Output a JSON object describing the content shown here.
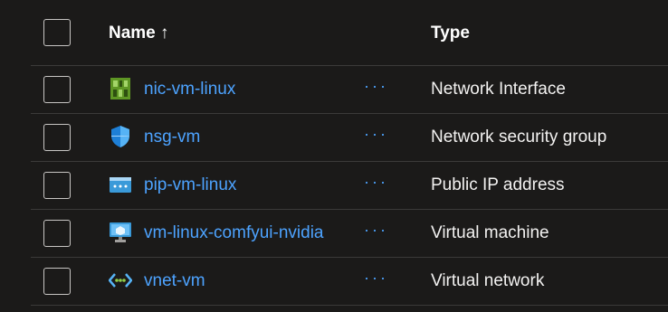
{
  "header": {
    "name_label": "Name ↑",
    "type_label": "Type"
  },
  "rows": [
    {
      "name": "nic-vm-linux",
      "type": "Network Interface",
      "icon": "network-interface-icon",
      "more": "···"
    },
    {
      "name": "nsg-vm",
      "type": "Network security group",
      "icon": "shield-icon",
      "more": "···"
    },
    {
      "name": "pip-vm-linux",
      "type": "Public IP address",
      "icon": "public-ip-icon",
      "more": "···"
    },
    {
      "name": "vm-linux-comfyui-nvidia",
      "type": "Virtual machine",
      "icon": "virtual-machine-icon",
      "more": "···"
    },
    {
      "name": "vnet-vm",
      "type": "Virtual network",
      "icon": "virtual-network-icon",
      "more": "···"
    }
  ],
  "colors": {
    "link": "#4da3ff",
    "background": "#1b1a19",
    "divider": "#3b3a39"
  }
}
